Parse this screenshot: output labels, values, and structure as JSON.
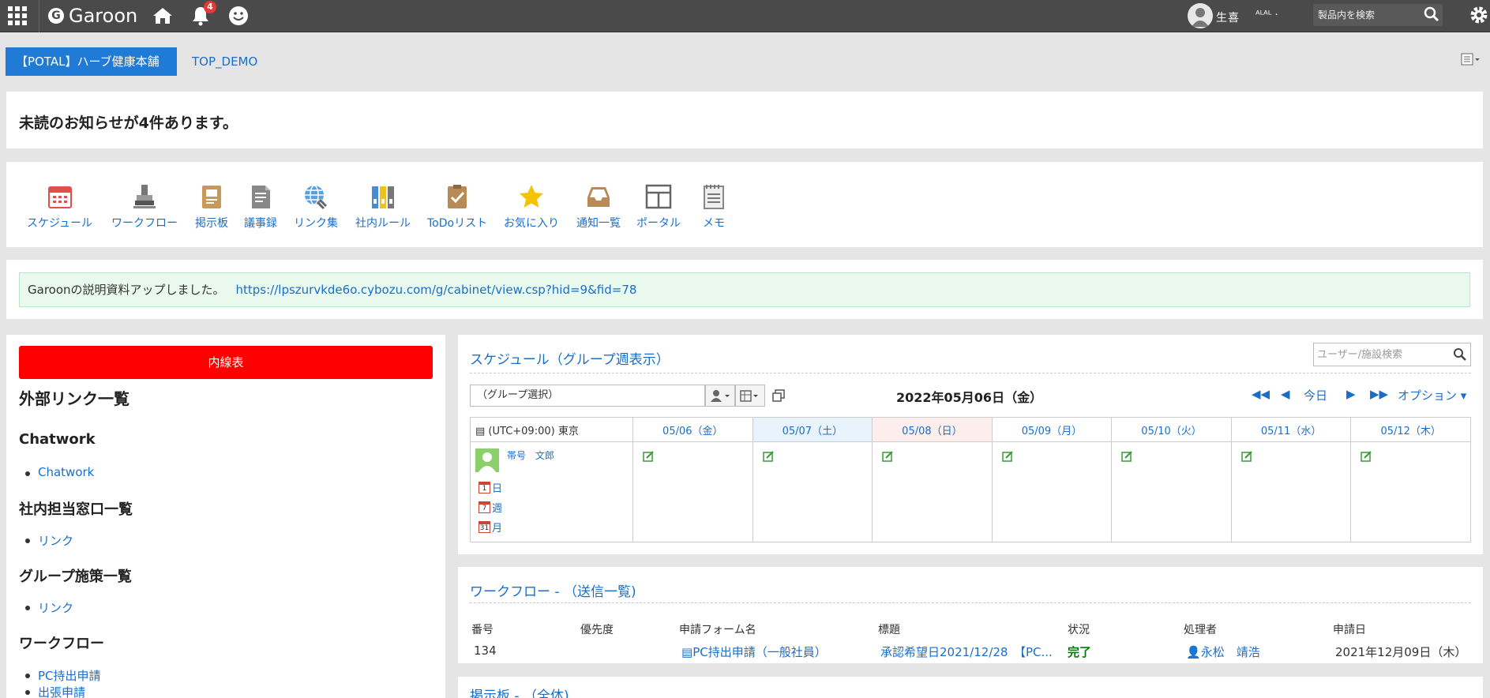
{
  "header": {
    "app_name": "Garoon",
    "notification_count": "4",
    "user_name": "生喜",
    "user_sub": "ᴬᴸᴬᴸ ·",
    "search_placeholder": "製品内を検索"
  },
  "tabs": [
    {
      "label": "【POTAL】ハーブ健康本舗",
      "active": true
    },
    {
      "label": "TOP_DEMO",
      "active": false
    }
  ],
  "notice": {
    "text": "未読のお知らせが4件あります。"
  },
  "apps": [
    {
      "label": "スケジュール",
      "icon": "calendar-icon"
    },
    {
      "label": "ワークフロー",
      "icon": "stamp-icon"
    },
    {
      "label": "掲示板",
      "icon": "board-icon"
    },
    {
      "label": "議事録",
      "icon": "minutes-icon"
    },
    {
      "label": "リンク集",
      "icon": "globe-link-icon"
    },
    {
      "label": "社内ルール",
      "icon": "binders-icon"
    },
    {
      "label": "ToDoリスト",
      "icon": "todo-icon"
    },
    {
      "label": "お気に入り",
      "icon": "star-icon"
    },
    {
      "label": "通知一覧",
      "icon": "inbox-icon"
    },
    {
      "label": "ポータル",
      "icon": "portal-icon"
    },
    {
      "label": "メモ",
      "icon": "memo-icon"
    }
  ],
  "info": {
    "text": "Garoonの説明資料アップしました。",
    "link": "https://lpszurvkde6o.cybozu.com/g/cabinet/view.csp?hid=9&fid=78"
  },
  "left": {
    "button": "内線表",
    "title": "外部リンク一覧",
    "sections": [
      {
        "heading": "Chatwork",
        "items": [
          "Chatwork"
        ]
      },
      {
        "heading": "社内担当窓口一覧",
        "items": [
          "リンク"
        ]
      },
      {
        "heading": "グループ施策一覧",
        "items": [
          "リンク"
        ]
      },
      {
        "heading": "ワークフロー",
        "items": [
          "PC持出申請",
          "出張申請"
        ]
      }
    ]
  },
  "schedule": {
    "title": "スケジュール（グループ週表示）",
    "user_search_placeholder": "ユーザー/施設検索",
    "group_select": "（グループ選択）",
    "date_title": "2022年05月06日（金）",
    "today": "今日",
    "options": "オプション",
    "timezone": "(UTC+09:00) 東京",
    "days": [
      "05/06（金）",
      "05/07（土）",
      "05/08（日）",
      "05/09（月）",
      "05/10（火）",
      "05/11（水）",
      "05/12（木）"
    ],
    "user": "帯号　文郎",
    "views": [
      "日",
      "週",
      "月"
    ],
    "view_icon_nums": [
      "1",
      "7",
      "31"
    ]
  },
  "workflow": {
    "title": "ワークフロー - （送信一覧)",
    "headers": [
      "番号",
      "優先度",
      "申請フォーム名",
      "標題",
      "状況",
      "処理者",
      "申請日"
    ],
    "row": {
      "number": "134",
      "priority": "",
      "form": "PC持出申請（一般社員）",
      "subject": "承認希望日2021/12/28　【PC...",
      "status": "完了",
      "handler": "永松　靖浩",
      "date": "2021年12月09日（木）"
    }
  },
  "board": {
    "title": "掲示板 - （全体)"
  },
  "colors": {
    "topbar": "#4a4a4a",
    "accent": "#1f7bd6",
    "link": "#1a6ec8",
    "red_button": "#fe0000",
    "info_bg": "#e9f9ee",
    "status_done": "#008000"
  }
}
